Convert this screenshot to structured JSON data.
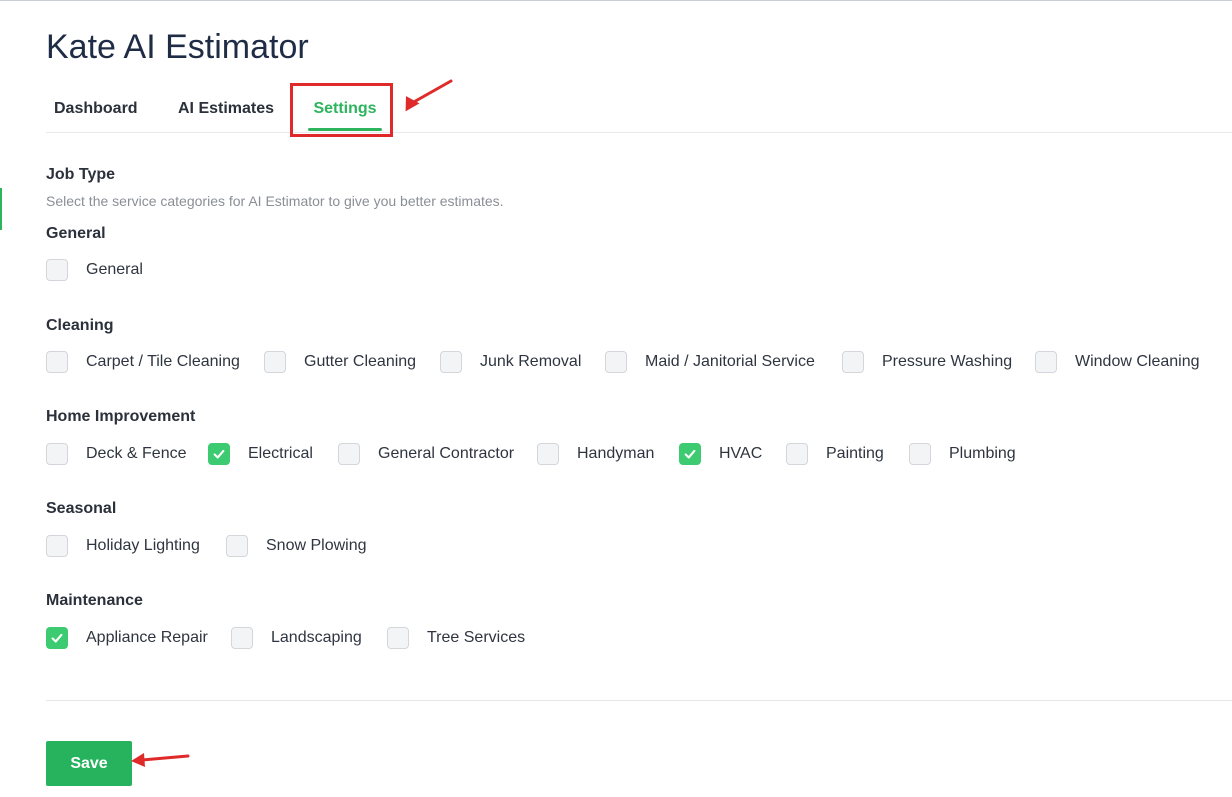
{
  "app": {
    "title": "Kate AI Estimator"
  },
  "tabs": [
    {
      "label": "Dashboard",
      "active": false
    },
    {
      "label": "AI Estimates",
      "active": false
    },
    {
      "label": "Settings",
      "active": true
    }
  ],
  "job_type": {
    "heading": "Job Type",
    "description": "Select the service categories for AI Estimator to give you better estimates.",
    "groups": [
      {
        "heading": "General",
        "options": [
          {
            "label": "General",
            "checked": false
          }
        ]
      },
      {
        "heading": "Cleaning",
        "options": [
          {
            "label": "Carpet / Tile Cleaning",
            "checked": false
          },
          {
            "label": "Gutter Cleaning",
            "checked": false
          },
          {
            "label": "Junk Removal",
            "checked": false
          },
          {
            "label": "Maid / Janitorial Service",
            "checked": false
          },
          {
            "label": "Pressure Washing",
            "checked": false
          },
          {
            "label": "Window Cleaning",
            "checked": false
          }
        ]
      },
      {
        "heading": "Home Improvement",
        "options": [
          {
            "label": "Deck & Fence",
            "checked": false
          },
          {
            "label": "Electrical",
            "checked": true
          },
          {
            "label": "General Contractor",
            "checked": false
          },
          {
            "label": "Handyman",
            "checked": false
          },
          {
            "label": "HVAC",
            "checked": true
          },
          {
            "label": "Painting",
            "checked": false
          },
          {
            "label": "Plumbing",
            "checked": false
          }
        ]
      },
      {
        "heading": "Seasonal",
        "options": [
          {
            "label": "Holiday Lighting",
            "checked": false
          },
          {
            "label": "Snow Plowing",
            "checked": false
          }
        ]
      },
      {
        "heading": "Maintenance",
        "options": [
          {
            "label": "Appliance Repair",
            "checked": true
          },
          {
            "label": "Landscaping",
            "checked": false
          },
          {
            "label": "Tree Services",
            "checked": false
          }
        ]
      }
    ]
  },
  "actions": {
    "save_label": "Save"
  },
  "colors": {
    "accent": "#2db45d",
    "checkbox_checked": "#3ccb70",
    "annotation": "#e02a2a"
  },
  "icons": {
    "checkmark": "check-icon",
    "annotation_arrow": "arrow-icon"
  }
}
